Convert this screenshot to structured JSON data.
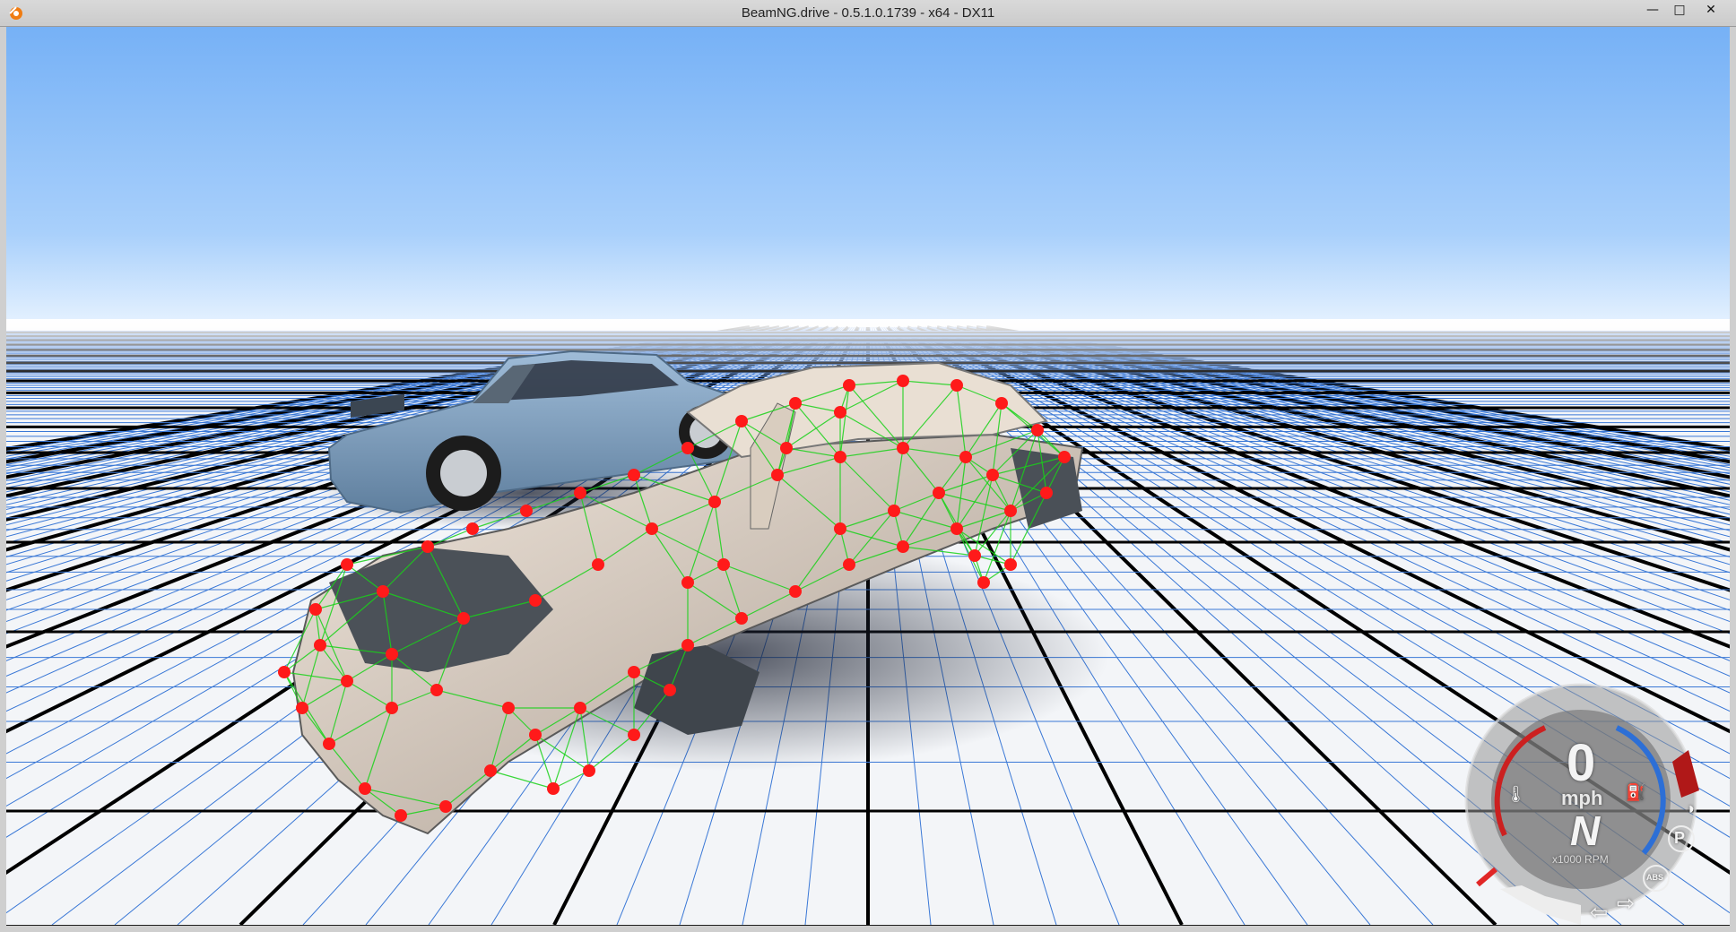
{
  "window": {
    "title": "BeamNG.drive - 0.5.1.0.1739 - x64 - DX11",
    "controls": {
      "minimize": "—",
      "maximize": "□",
      "close": "✕"
    }
  },
  "scene": {
    "sky_colors": [
      "#7ab4f6",
      "#d8ecff"
    ],
    "grid_colors": {
      "major": "#000000",
      "minor": "#3a78d6",
      "background": "#f4f6f8"
    },
    "vehicles": [
      {
        "name": "blue-sedan",
        "color": "#7f9fbf"
      },
      {
        "name": "stripped-wagon-body",
        "node_color": "#ff1a1a",
        "beam_color": "#19d219"
      }
    ]
  },
  "hud": {
    "speed_value": "0",
    "speed_unit": "mph",
    "gear": "N",
    "rpm_unit": "x1000 RPM",
    "park_indicator": "P",
    "abs_indicator": "ABS",
    "icons": [
      "temperature-icon",
      "fuel-icon",
      "headlight-icon",
      "turn-left-icon",
      "turn-right-icon"
    ]
  }
}
